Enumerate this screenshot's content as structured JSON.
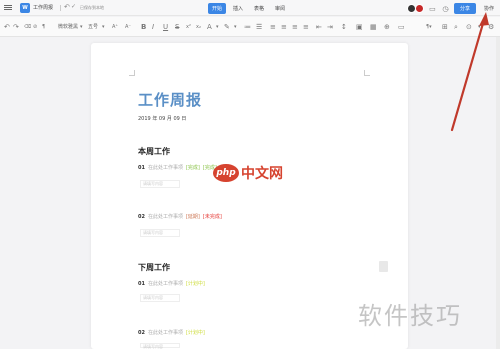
{
  "titlebar": {
    "doc_name": "工作周报",
    "status": "已保存到本地",
    "tabs": [
      "开始",
      "插入",
      "表格",
      "审阅"
    ],
    "active_tab": 0,
    "share_label": "分享",
    "more_label": "协作"
  },
  "toolbar": {
    "font_name": "微软雅黑",
    "font_size": "五号"
  },
  "document": {
    "title": "工作周报",
    "date": "2019 年 09 月 09 日",
    "sections": [
      {
        "heading": "本周工作",
        "items": [
          {
            "num": "01",
            "text": "在此处工作事项",
            "tag": "[完成]",
            "tag2": "[完成]",
            "tag_color": "#8bc34a",
            "sub": "请填写内容"
          },
          {
            "num": "02",
            "text": "在此处工作事项",
            "tag": "[延期]",
            "tag2": "[未完成]",
            "tag_color": "#e53935",
            "sub": "请填写内容"
          }
        ]
      },
      {
        "heading": "下周工作",
        "items": [
          {
            "num": "01",
            "text": "在此处工作事项",
            "tag": "[计划中]",
            "tag2": "",
            "tag_color": "#cddc39",
            "sub": "请填写内容"
          },
          {
            "num": "02",
            "text": "在此处工作事项",
            "tag": "[计划中]",
            "tag2": "",
            "tag_color": "#cddc39",
            "sub": "请填写内容"
          }
        ]
      }
    ]
  },
  "watermarks": {
    "php_logo": "php",
    "php_text": "中文网",
    "bottom": "软件技巧"
  },
  "colors": {
    "accent": "#3b86e5",
    "title": "#5a8fc6",
    "arrow": "#c0392b"
  }
}
